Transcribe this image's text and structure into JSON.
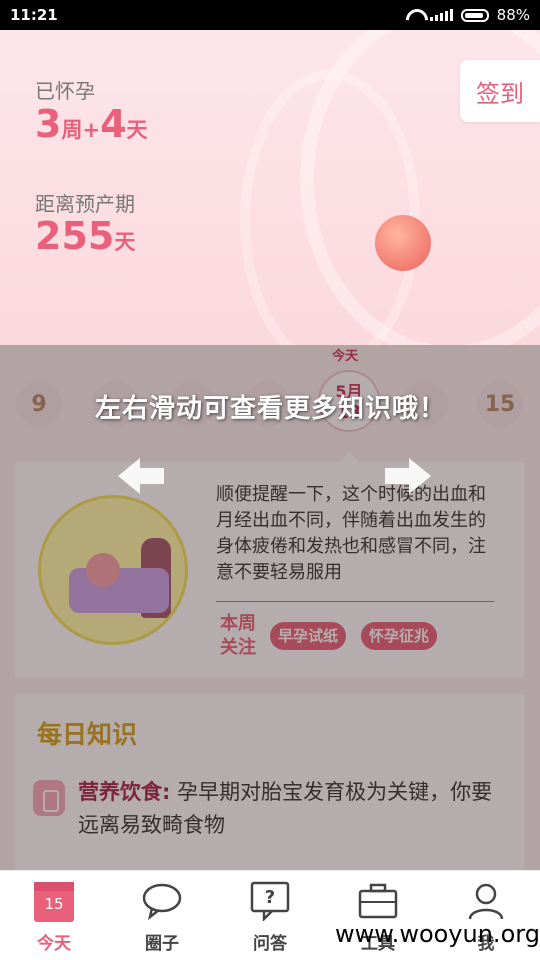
{
  "status_bar": {
    "time": "11:21",
    "battery": "88%"
  },
  "header": {
    "pregnant_label": "已怀孕",
    "weeks_num": "3",
    "weeks_unit": "周+",
    "days_num": "4",
    "days_unit": "天",
    "due_label": "距离预产期",
    "due_num": "255",
    "due_unit": "天",
    "checkin_label": "签到"
  },
  "day_strip": {
    "today_label": "今天",
    "today_month": "5月",
    "today_day": "13",
    "days": [
      "9",
      "15"
    ]
  },
  "tip_card": {
    "text": "顺便提醒一下，这个时候的出血和月经出血不同，伴随着出血发生的身体疲倦和发热也和感冒不同，注意不要轻易服用",
    "focus_label": "本周关注",
    "tags": [
      "早孕试纸",
      "怀孕征兆"
    ]
  },
  "overlay": {
    "hint": "左右滑动可查看更多知识哦！"
  },
  "daily_knowledge": {
    "title": "每日知识",
    "keyword": "营养饮食:",
    "text": " 孕早期对胎宝发育极为关键，你要远离易致畸食物"
  },
  "bottom_nav": {
    "items": [
      {
        "label": "今天",
        "icon": "calendar-icon",
        "badge": "15"
      },
      {
        "label": "圈子",
        "icon": "chat-bubble-icon"
      },
      {
        "label": "问答",
        "icon": "question-icon"
      },
      {
        "label": "工具",
        "icon": "toolbox-icon"
      },
      {
        "label": "我",
        "icon": "person-icon"
      }
    ]
  },
  "watermark": "www.wooyun.org",
  "colors": {
    "accent": "#e8607a",
    "knowledge_title": "#d4a017"
  }
}
